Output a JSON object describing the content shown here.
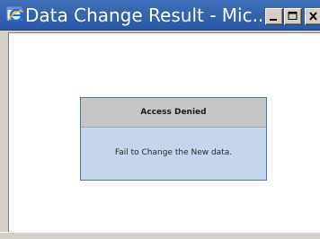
{
  "window": {
    "title": "Data Change Result - Mic...",
    "app_icon": "internet-explorer-icon",
    "controls": [
      "minimize-icon",
      "maximize-icon",
      "close-icon"
    ]
  },
  "dialog": {
    "header": "Access Denied",
    "message": "Fail to Change the New data."
  },
  "colors": {
    "titlebar": "#2a58a8",
    "dialog_header_bg": "#c6c6c6",
    "dialog_body_bg": "#c5d5eb",
    "dialog_border": "#4a78b5"
  }
}
